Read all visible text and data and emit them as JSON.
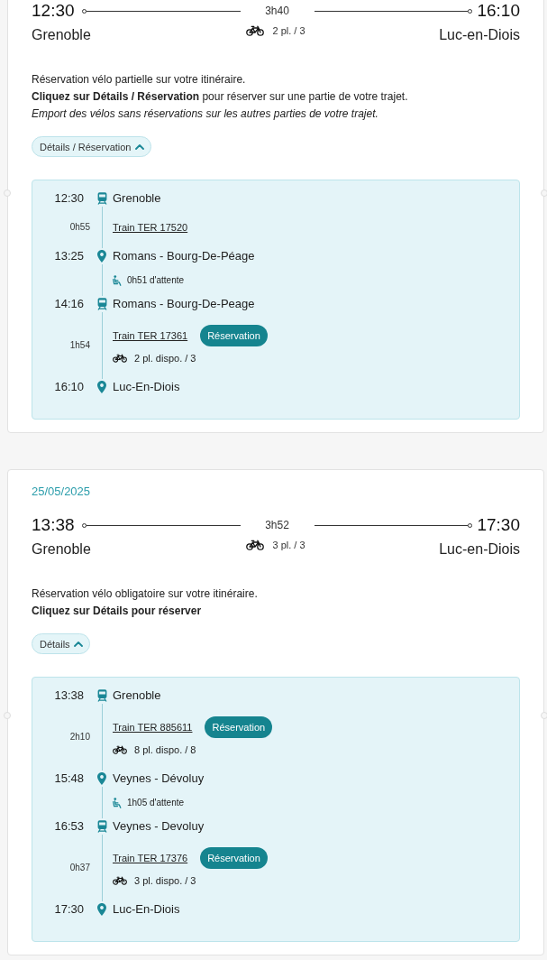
{
  "journeys": [
    {
      "departure": {
        "time": "12:30",
        "station": "Grenoble"
      },
      "duration": "3h40",
      "arrival": {
        "time": "16:10",
        "station": "Luc-en-Diois"
      },
      "bike_places": "2 pl. / 3",
      "notice": [
        {
          "kind": "plain",
          "text": "Réservation vélo partielle sur votre itinéraire."
        },
        {
          "kind": "plain",
          "text": "**Cliquez sur Détails / Réservation** pour réserver sur une partie de votre trajet."
        },
        {
          "kind": "italic",
          "text": "Emport des vélos sans réservations sur les autres parties de votre trajet."
        }
      ],
      "details_button": {
        "label": "Détails / Réservation",
        "expanded": true
      },
      "itinerary": [
        {
          "kind": "departure",
          "time": "12:30",
          "station": "Grenoble"
        },
        {
          "kind": "segment",
          "duration": "0h55",
          "train": "Train TER 17520"
        },
        {
          "kind": "arrival",
          "time": "13:25",
          "station": "Romans - Bourg-De-Péage"
        },
        {
          "kind": "wait",
          "text": "0h51 d'attente"
        },
        {
          "kind": "departure",
          "time": "14:16",
          "station": "Romans - Bourg-De-Peage"
        },
        {
          "kind": "segment",
          "duration": "1h54",
          "train": "Train TER 17361",
          "reservation": "Réservation",
          "bike_places": "2 pl. dispo. / 3"
        },
        {
          "kind": "arrival",
          "time": "16:10",
          "station": "Luc-En-Diois"
        }
      ]
    },
    {
      "date": "25/05/2025",
      "departure": {
        "time": "13:38",
        "station": "Grenoble"
      },
      "duration": "3h52",
      "arrival": {
        "time": "17:30",
        "station": "Luc-en-Diois"
      },
      "bike_places": "3 pl. / 3",
      "notice": [
        {
          "kind": "plain",
          "text": "Réservation vélo obligatoire sur votre itinéraire."
        },
        {
          "kind": "bold",
          "text": "Cliquez sur Détails pour réserver"
        }
      ],
      "details_button": {
        "label": "Détails",
        "expanded": true
      },
      "itinerary": [
        {
          "kind": "departure",
          "time": "13:38",
          "station": "Grenoble"
        },
        {
          "kind": "segment",
          "duration": "2h10",
          "train": "Train TER 885611",
          "reservation": "Réservation",
          "bike_places": "8 pl. dispo. / 8"
        },
        {
          "kind": "arrival",
          "time": "15:48",
          "station": "Veynes - Dévoluy"
        },
        {
          "kind": "wait",
          "text": "1h05 d'attente"
        },
        {
          "kind": "departure",
          "time": "16:53",
          "station": "Veynes - Devoluy"
        },
        {
          "kind": "segment",
          "duration": "0h37",
          "train": "Train TER 17376",
          "reservation": "Réservation",
          "bike_places": "3 pl. dispo. / 3"
        },
        {
          "kind": "arrival",
          "time": "17:30",
          "station": "Luc-En-Diois"
        }
      ]
    }
  ]
}
